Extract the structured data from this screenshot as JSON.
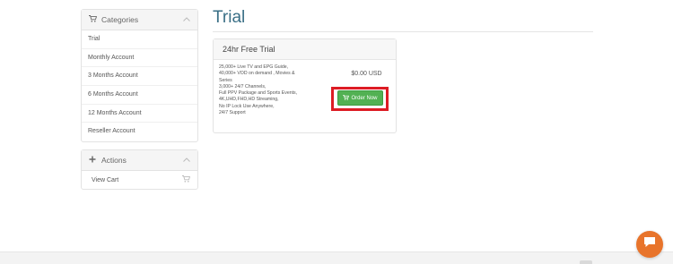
{
  "categories": {
    "title": "Categories",
    "items": [
      {
        "label": "Trial"
      },
      {
        "label": "Monthly Account"
      },
      {
        "label": "3 Months Account"
      },
      {
        "label": "6 Months Account"
      },
      {
        "label": "12 Months Account"
      },
      {
        "label": "Reseller Account"
      }
    ]
  },
  "actions": {
    "title": "Actions",
    "items": [
      {
        "label": "View Cart"
      }
    ]
  },
  "page": {
    "title": "Trial"
  },
  "product": {
    "name": "24hr Free Trial",
    "features": [
      "25,000+ Live TV and EPG Guide,",
      "40,000+ VOD on demand , Movies &",
      "Series",
      "3,000+ 24/7 Channels,",
      "Full PPV Package and Sports Events,",
      "4K,UHD,FHD,HD Streaming,",
      "No IP Lock Use Anywhere,",
      "24/7 Support"
    ],
    "price": "$0.00 USD",
    "order_label": "Order Now"
  },
  "icons": {
    "categories": "cart-icon",
    "actions": "plus-icon",
    "collapse": "chevron-up-icon",
    "view_cart": "cart-icon",
    "chat": "chat-bubble-icon"
  },
  "colors": {
    "title": "#3a6f86",
    "order_button": "#52b153",
    "highlight": "#dd1c24",
    "chat": "#e8742b"
  }
}
